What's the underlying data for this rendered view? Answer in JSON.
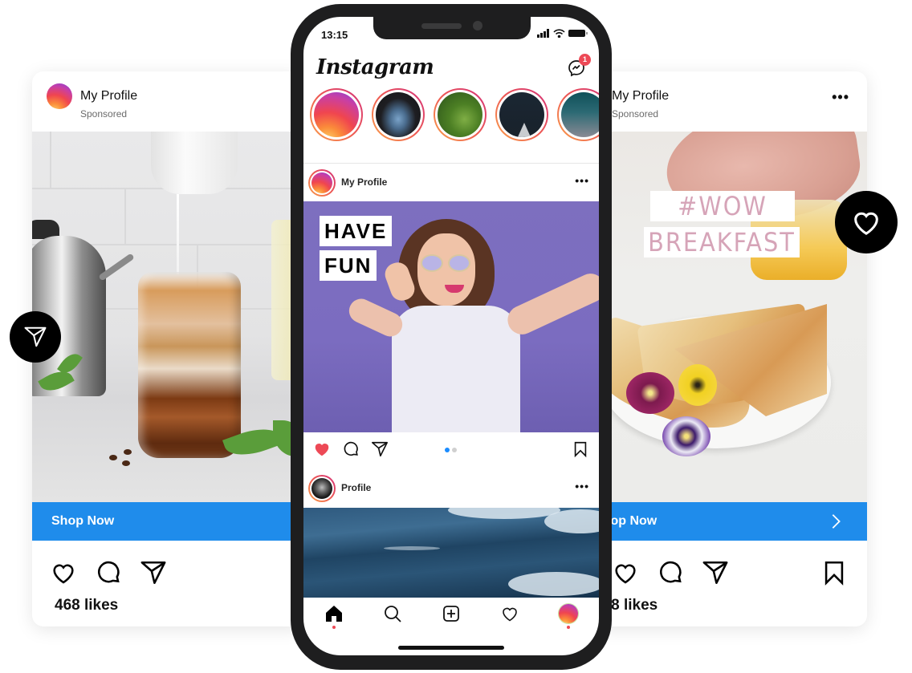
{
  "left_ad": {
    "profile_name": "My Profile",
    "sponsored_label": "Sponsored",
    "cta_label": "Shop Now",
    "likes_text": "468 likes",
    "image_subject": "iced coffee with milk"
  },
  "right_ad": {
    "profile_name": "My Profile",
    "sponsored_label": "Sponsored",
    "more_label": "•••",
    "cta_label": "Shop Now",
    "likes_text": "468 likes",
    "overlay_line1": "#WOW",
    "overlay_line2": "BREAKFAST",
    "image_subject": "crepes with edible flowers"
  },
  "floating": {
    "send_icon": "send-icon",
    "heart_icon": "heart-icon"
  },
  "phone": {
    "status_time": "13:15",
    "app_title": "Instagram",
    "dm_badge_count": "1",
    "stories": [
      {
        "name": "my-story",
        "style": "gradient"
      },
      {
        "name": "story-person-denim",
        "style": "photo"
      },
      {
        "name": "story-leaves",
        "style": "photo"
      },
      {
        "name": "story-building",
        "style": "photo"
      },
      {
        "name": "story-moon",
        "style": "photo"
      }
    ],
    "post1": {
      "profile_name": "My Profile",
      "more_label": "•••",
      "overlay_line1": "HAVE",
      "overlay_line2": "FUN",
      "liked": true,
      "carousel_index": 1,
      "carousel_total": 2
    },
    "post2": {
      "profile_name": "Profile",
      "more_label": "•••"
    },
    "bottom_nav": [
      "home",
      "search",
      "new-post",
      "activity",
      "profile"
    ],
    "active_tab": "home"
  },
  "colors": {
    "cta_blue": "#1f8ceb",
    "like_red": "#ed4956",
    "carousel_active": "#1a8cff",
    "overlay_pink": "#d6a4b8"
  }
}
